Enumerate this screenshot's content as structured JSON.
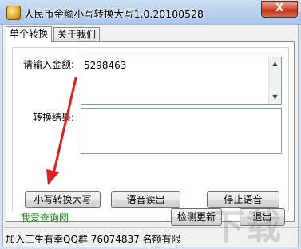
{
  "window": {
    "title": "人民币金额小写转换大写1.0.20100528",
    "close_label": "X"
  },
  "tabs": [
    {
      "label": "单个转换",
      "active": true
    },
    {
      "label": "关于我们",
      "active": false
    }
  ],
  "form": {
    "input_label": "请输入金额:",
    "input_value": "5298463",
    "result_label": "转换结果:",
    "result_value": ""
  },
  "buttons": {
    "convert": "小写转换大写",
    "speak": "语音读出",
    "stop": "停止语音",
    "update": "检测更新",
    "exit": "退出"
  },
  "link": "我爱查询网",
  "status": "加入三生有幸QQ群 76074837 名额有限",
  "colors": {
    "arrow": "#e02020",
    "link": "#1f8a1f",
    "close": "#c0321a"
  }
}
